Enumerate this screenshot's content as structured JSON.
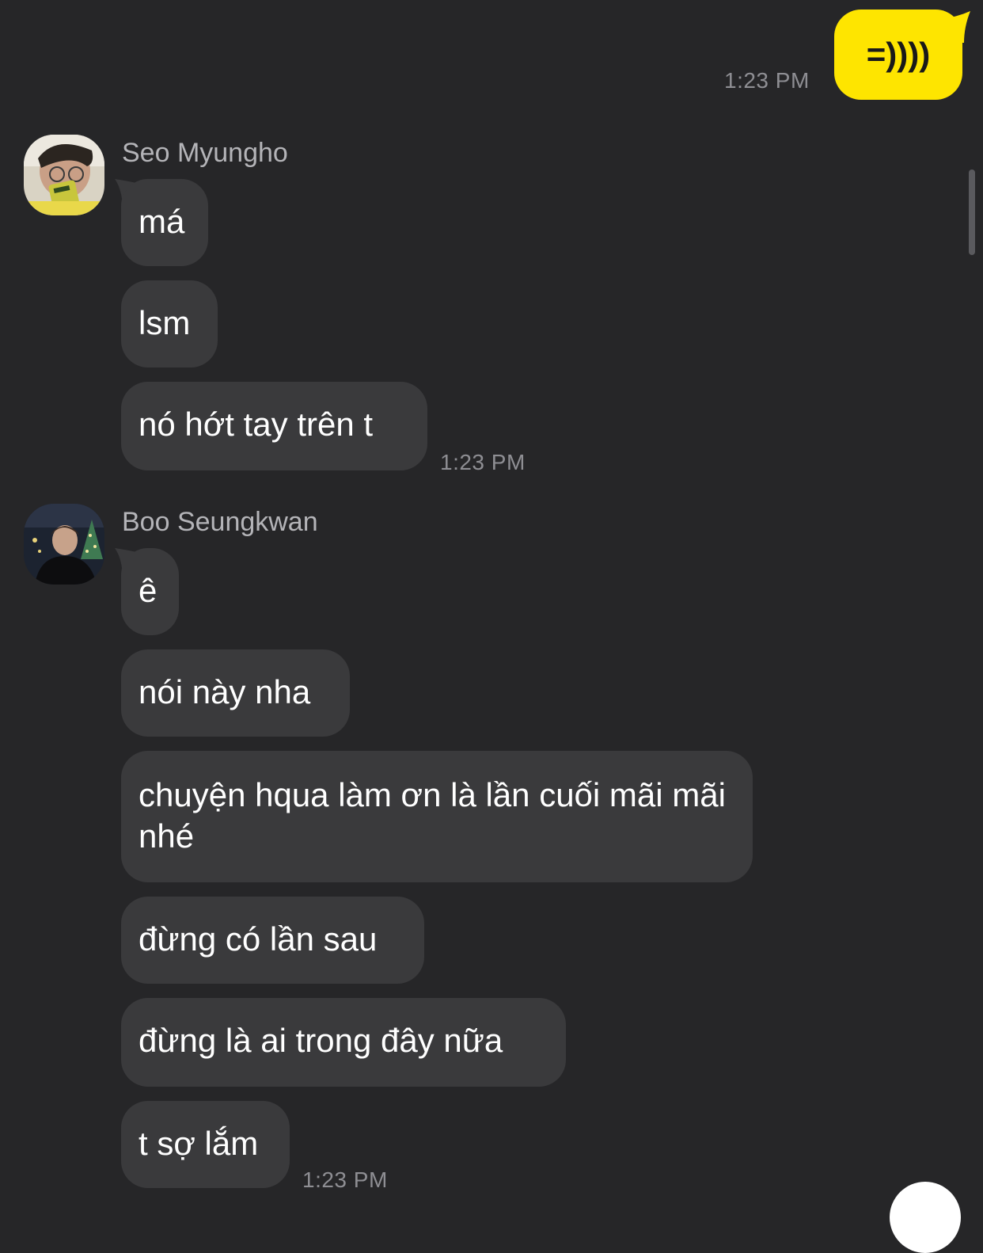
{
  "outgoing": {
    "message": "=))))",
    "time": "1:23 PM"
  },
  "groups": [
    {
      "sender": "Seo Myungho",
      "avatar_icon": "user-photo-avatar",
      "messages": [
        "má",
        "lsm",
        "nó hớt tay trên t"
      ],
      "time": "1:23 PM"
    },
    {
      "sender": "Boo Seungkwan",
      "avatar_icon": "user-photo-avatar",
      "messages": [
        "ê",
        "nói này nha",
        "chuyện hqua làm ơn là lần cuối mãi mãi nhé",
        "đừng có lần sau",
        "đừng là ai trong đây nữa",
        "t sợ lắm"
      ],
      "time": "1:23 PM"
    }
  ],
  "colors": {
    "background": "#262628",
    "outgoing_bubble": "#fee500",
    "incoming_bubble": "#3a3a3c",
    "timestamp": "#8e8e93",
    "sender_name": "#b4b4b8"
  }
}
